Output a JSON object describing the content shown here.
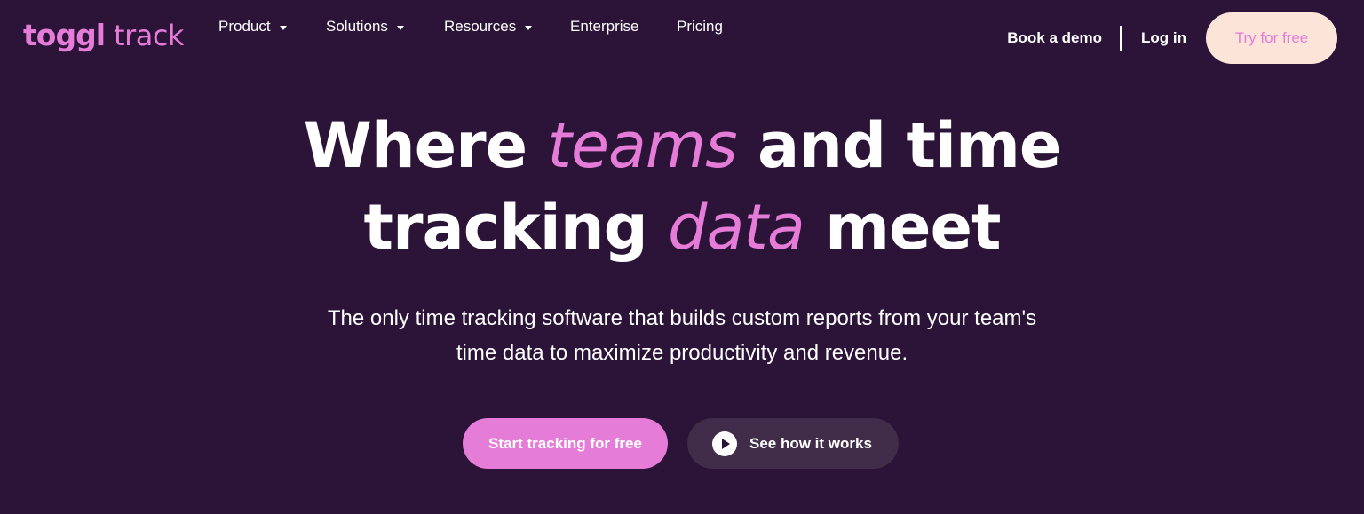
{
  "nav": {
    "logo": {
      "wordmark_bold": "toggl",
      "wordmark_light": "track"
    },
    "menu": [
      {
        "label": "Product",
        "has_dropdown": true,
        "icon": "chevron-down-icon"
      },
      {
        "label": "Solutions",
        "has_dropdown": true,
        "icon": "chevron-down-icon"
      },
      {
        "label": "Resources",
        "has_dropdown": true,
        "icon": "chevron-down-icon"
      },
      {
        "label": "Enterprise",
        "has_dropdown": false
      },
      {
        "label": "Pricing",
        "has_dropdown": false
      }
    ],
    "book_demo": "Book a demo",
    "log_in": "Log in",
    "try_free": "Try for free"
  },
  "hero": {
    "title_line1": {
      "before": "Where ",
      "accent": "teams",
      "after": " and time"
    },
    "title_line2": {
      "before": "tracking ",
      "accent": "data",
      "after": " meet"
    },
    "subtitle_line1": "The only time tracking software that builds custom reports from your team's",
    "subtitle_line2": "time data to maximize productivity and revenue.",
    "cta_primary": "Start tracking for free",
    "cta_secondary": "See how it works",
    "cta_secondary_icon": "play-icon"
  },
  "colors": {
    "background": "#2c1338",
    "accent_pink": "#e57cd8",
    "try_free_bg": "#fce5d8",
    "secondary_button_bg": "#412c4a",
    "text": "#ffffff"
  }
}
